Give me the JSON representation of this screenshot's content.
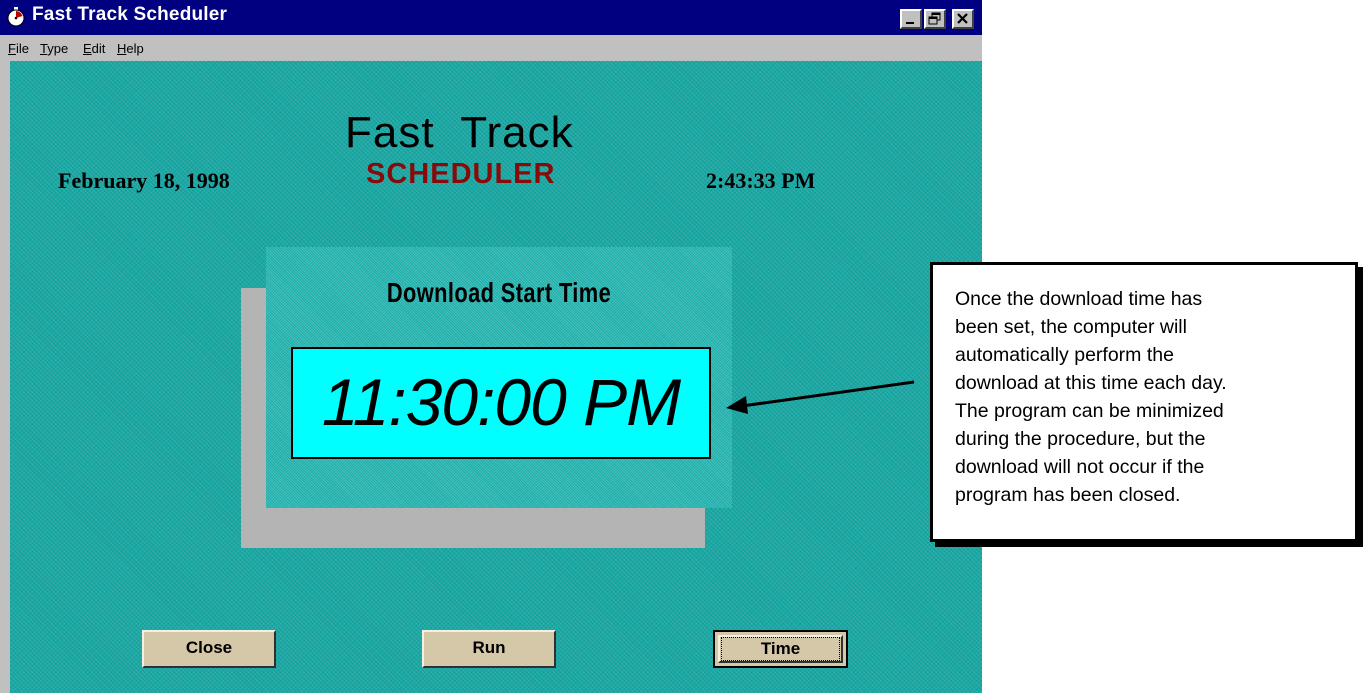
{
  "window": {
    "title": "Fast Track Scheduler"
  },
  "menu": {
    "items": [
      {
        "underline": "F",
        "rest": "ile"
      },
      {
        "underline": "T",
        "rest": "ype"
      },
      {
        "underline": "E",
        "rest": "dit"
      },
      {
        "underline": "H",
        "rest": "elp"
      }
    ]
  },
  "header": {
    "title": "Fast  Track",
    "subtitle": "SCHEDULER",
    "date": "February 18, 1998",
    "clock": "2:43:33 PM"
  },
  "download_panel": {
    "heading": "Download Start Time",
    "time": "11:30:00 PM"
  },
  "buttons": {
    "close": "Close",
    "run": "Run",
    "time": "Time"
  },
  "annotation": {
    "lines": [
      "Once the download time has",
      "been set, the computer will",
      "automatically perform the",
      "download at this time each day.",
      "The program can be minimized",
      "during the procedure, but the",
      "download will not occur if the",
      "program has been closed."
    ]
  },
  "colors": {
    "titlebar": "#000080",
    "client_background": "#1aa8a4",
    "time_display": "#00ffff",
    "subtitle": "#8a0a0a",
    "button_face": "#d4c8a8"
  },
  "icons": [
    "stopwatch-icon",
    "minimize-icon",
    "maximize-icon",
    "close-icon",
    "arrow-icon"
  ]
}
